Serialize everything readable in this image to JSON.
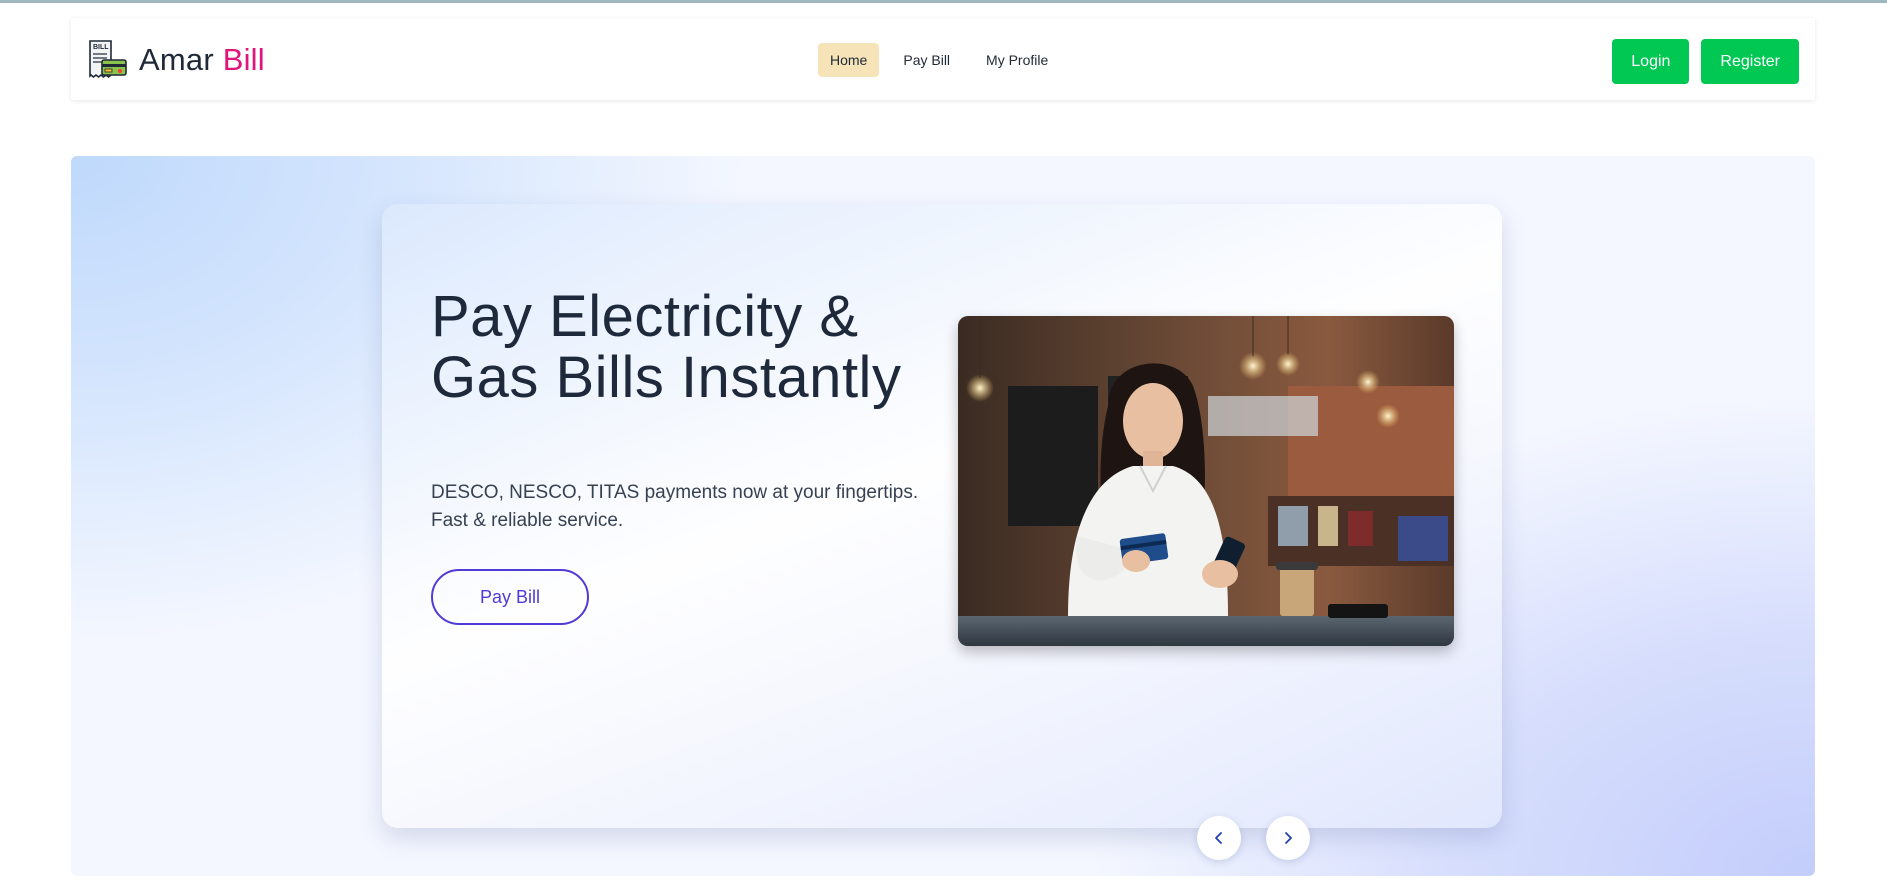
{
  "brand": {
    "name_first": "Amar ",
    "name_accent": "Bill",
    "logo_icon": "bill-receipt-icon",
    "logo_text": "BILL",
    "accent_color": "#e0147a"
  },
  "nav": {
    "items": [
      {
        "label": "Home",
        "active": true
      },
      {
        "label": "Pay Bill",
        "active": false
      },
      {
        "label": "My Profile",
        "active": false
      }
    ],
    "active_bg": "#f6e3b7"
  },
  "auth": {
    "login_label": "Login",
    "register_label": "Register",
    "button_color": "#00c853"
  },
  "hero": {
    "title": "Pay Electricity & Gas Bills Instantly",
    "subtitle": "DESCO, NESCO, TITAS payments now at your fingertips. Fast & reliable service.",
    "cta_label": "Pay Bill",
    "cta_color": "#4f3bd6",
    "image": {
      "icon": "woman-paying-with-card-photo"
    },
    "controls": {
      "prev_icon": "chevron-left-icon",
      "next_icon": "chevron-right-icon"
    }
  }
}
